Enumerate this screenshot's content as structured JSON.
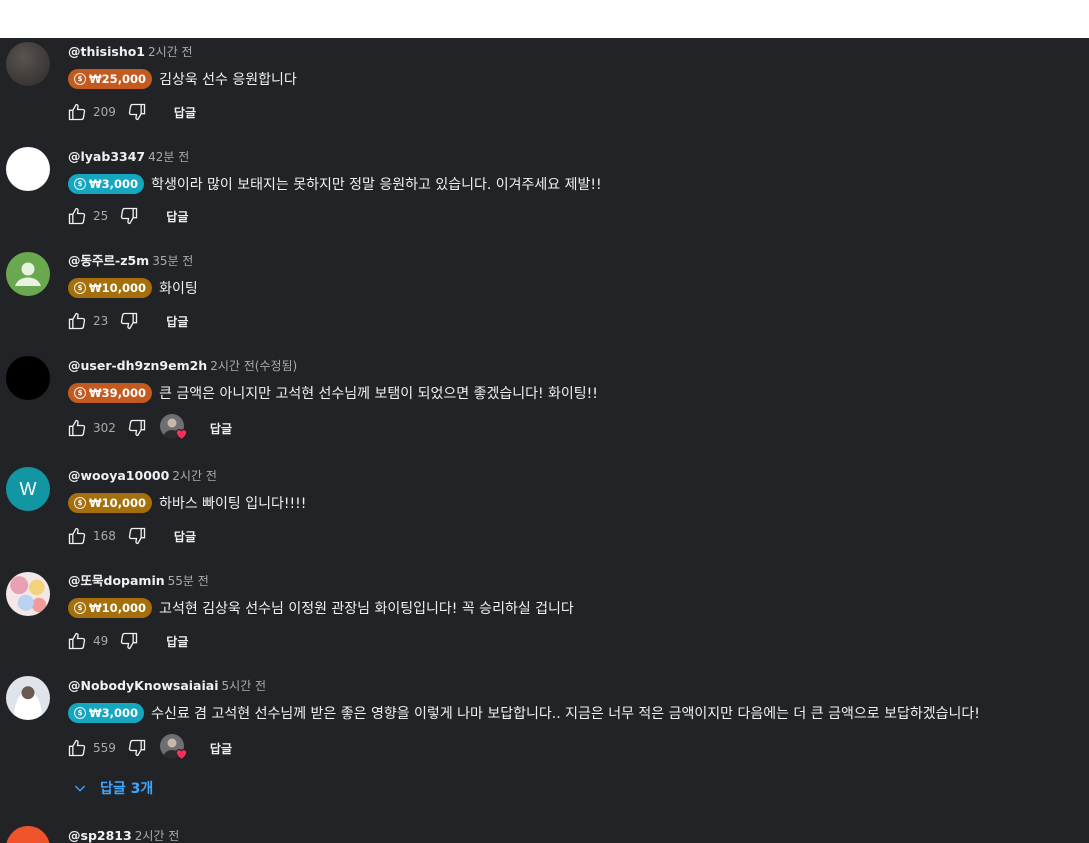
{
  "comments": [
    {
      "handle": "@thisisho1",
      "time": "2시간 전",
      "amount": "₩25,000",
      "chip_color": "#c35a20",
      "text": "김상욱 선수 응원합니다",
      "likes": "209",
      "reply": "답글",
      "avatar": "photo-dark",
      "hearted": false
    },
    {
      "handle": "@lyab3347",
      "time": "42분 전",
      "amount": "₩3,000",
      "chip_color": "#15a6c0",
      "text": "학생이라 많이 보태지는 못하지만 정말 응원하고 있습니다. 이겨주세요 제발!!",
      "likes": "25",
      "reply": "답글",
      "avatar": "white",
      "hearted": false
    },
    {
      "handle": "@동주르-z5m",
      "time": "35분 전",
      "amount": "₩10,000",
      "chip_color": "#a56f0c",
      "text": "화이팅",
      "likes": "23",
      "reply": "답글",
      "avatar": "default-green",
      "hearted": false
    },
    {
      "handle": "@user-dh9zn9em2h",
      "time": "2시간 전(수정됨)",
      "amount": "₩39,000",
      "chip_color": "#c35a20",
      "text": "큰 금액은 아니지만 고석현 선수님께 보탬이 되었으면 좋겠습니다! 화이팅!!",
      "likes": "302",
      "reply": "답글",
      "avatar": "black",
      "hearted": true
    },
    {
      "handle": "@wooya10000",
      "time": "2시간 전",
      "amount": "₩10,000",
      "chip_color": "#a56f0c",
      "text": "하바스 빠이팅 입니다!!!!",
      "likes": "168",
      "reply": "답글",
      "avatar": "letter",
      "avatar_letter": "W",
      "hearted": false
    },
    {
      "handle": "@또묵dopamin",
      "time": "55분 전",
      "amount": "₩10,000",
      "chip_color": "#a56f0c",
      "text": "고석현 김상욱 선수님 이정원 관장님 화이팅입니다! 꼭 승리하실 겁니다",
      "likes": "49",
      "reply": "답글",
      "avatar": "photo-pattern",
      "hearted": false
    },
    {
      "handle": "@NobodyKnowsaiaiai",
      "time": "5시간 전",
      "amount": "₩3,000",
      "chip_color": "#15a6c0",
      "text": "수신료 겸 고석현 선수님께 받은 좋은 영향을 이렇게 나마 보답합니다.. 지금은 너무 적은 금액이지만 다음에는 더 큰 금액으로 보답하겠습니다!",
      "likes": "559",
      "reply": "답글",
      "avatar": "photo-light",
      "hearted": true,
      "replies_toggle": "답글 3개"
    },
    {
      "handle": "@sp2813",
      "time": "2시간 전",
      "avatar": "orange"
    }
  ],
  "colors": {
    "background": "#212326",
    "link": "#3ea6ff",
    "muted": "#aaaaaa"
  }
}
